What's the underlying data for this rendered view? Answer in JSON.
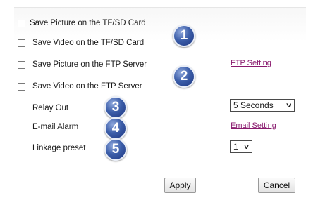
{
  "options": [
    {
      "label": "Save Picture on the TF/SD Card"
    },
    {
      "label": "Save Video on the TF/SD Card"
    },
    {
      "label": "Save Picture on the FTP Server"
    },
    {
      "label": "Save Video on the FTP Server"
    },
    {
      "label": "Relay Out"
    },
    {
      "label": "E-mail Alarm"
    },
    {
      "label": "Linkage preset"
    }
  ],
  "badges": [
    "1",
    "2",
    "3",
    "4",
    "5"
  ],
  "links": {
    "ftp_setting": "FTP Setting",
    "email_setting": "Email Setting"
  },
  "selects": {
    "relay_duration": "5 Seconds",
    "preset": "1"
  },
  "buttons": {
    "apply": "Apply",
    "cancel": "Cancel"
  },
  "colors": {
    "badge": "#3d5faa",
    "link": "#8a1a6e"
  }
}
